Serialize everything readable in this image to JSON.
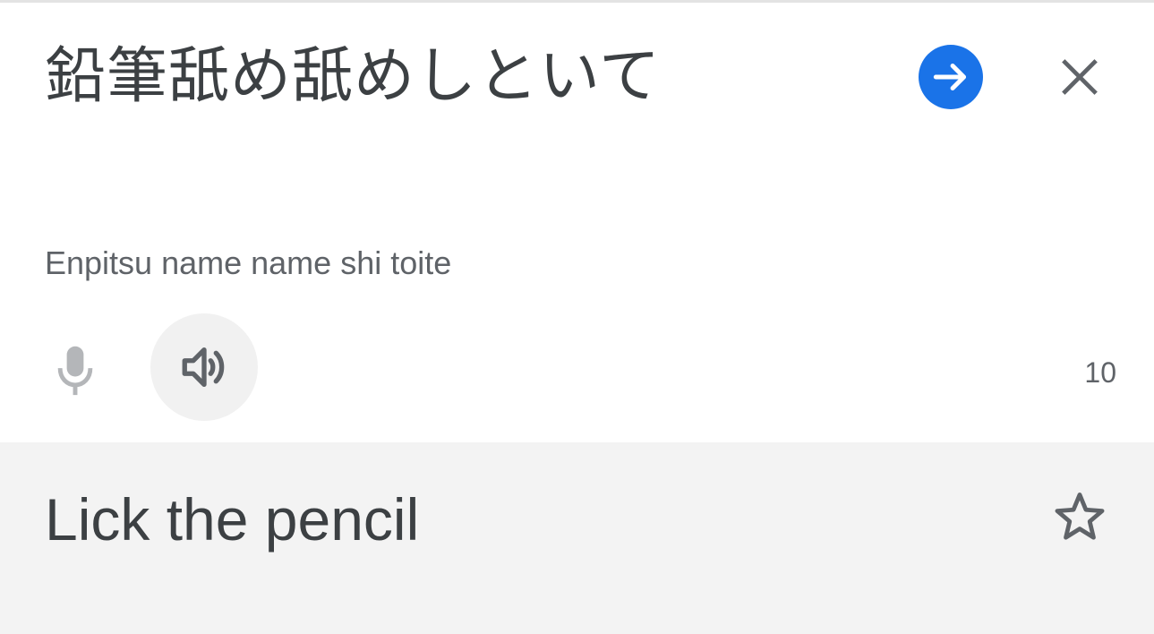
{
  "source": {
    "text": "鉛筆舐め舐めしといて",
    "romanization": "Enpitsu name name shi toite",
    "char_count": "10"
  },
  "result": {
    "translation": "Lick the pencil"
  },
  "icons": {
    "go": "arrow-forward-icon",
    "close": "close-icon",
    "mic": "microphone-icon",
    "speaker": "volume-icon",
    "star": "star-outline-icon"
  },
  "colors": {
    "accent": "#1a73e8",
    "text_primary": "#3c4043",
    "text_secondary": "#5f6368",
    "result_background": "#f3f3f3",
    "speaker_background": "#f1f1f1"
  }
}
